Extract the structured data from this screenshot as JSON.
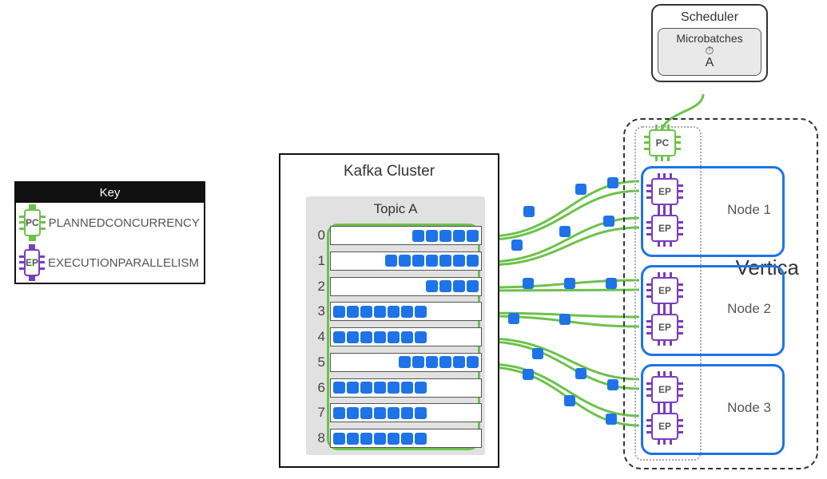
{
  "diagram": {
    "key": {
      "title": "Key",
      "pc_abbr": "PC",
      "pc_label": "PLANNEDCONCURRENCY",
      "ep_abbr": "EP",
      "ep_label": "EXECUTIONPARALLELISM"
    },
    "scheduler": {
      "title": "Scheduler",
      "box_label": "Microbatches",
      "clock_glyph": "⏱",
      "microbatch_name": "A"
    },
    "kafka": {
      "title": "Kafka Cluster",
      "topic_title": "Topic A",
      "partitions": [
        {
          "index": "0",
          "messages": 5,
          "align": "right"
        },
        {
          "index": "1",
          "messages": 7,
          "align": "right"
        },
        {
          "index": "2",
          "messages": 4,
          "align": "right"
        },
        {
          "index": "3",
          "messages": 7,
          "align": "left"
        },
        {
          "index": "4",
          "messages": 7,
          "align": "left"
        },
        {
          "index": "5",
          "messages": 6,
          "align": "right"
        },
        {
          "index": "6",
          "messages": 7,
          "align": "left"
        },
        {
          "index": "7",
          "messages": 7,
          "align": "left"
        },
        {
          "index": "8",
          "messages": 7,
          "align": "left"
        }
      ]
    },
    "vertica": {
      "label": "Vertica",
      "pc_abbr": "PC",
      "nodes": [
        {
          "name": "Node 1",
          "ep_abbr": "EP"
        },
        {
          "name": "Node 2",
          "ep_abbr": "EP"
        },
        {
          "name": "Node 3",
          "ep_abbr": "EP"
        }
      ]
    },
    "routing_note": "Each of the 6 EP chips (2 per node) consumes from Topic A partitions via green streams carrying blue message squares; the scheduler's microbatch A feeds the single PC chip which fans out to the nodes."
  }
}
